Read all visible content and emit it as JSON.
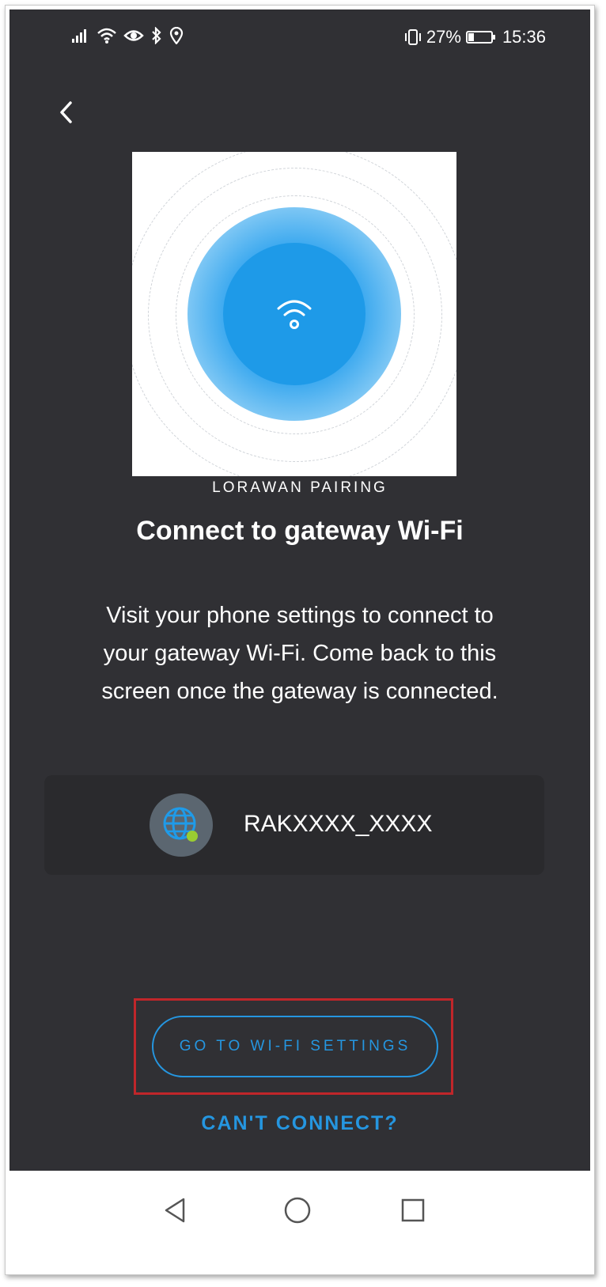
{
  "status_bar": {
    "battery_percent_text": "27%",
    "battery_level": 0.27,
    "time": "15:36",
    "icons": [
      "signal-icon",
      "wifi-icon",
      "eye-icon",
      "bluetooth-icon",
      "location-icon",
      "vibrate-icon",
      "battery-icon"
    ]
  },
  "header": {
    "back_icon": "chevron-left-icon"
  },
  "content": {
    "overline": "LORAWAN PAIRING",
    "title": "Connect to gateway Wi-Fi",
    "description": "Visit your phone settings to connect to your gateway Wi-Fi. Come back to this screen once the gateway is connected."
  },
  "network": {
    "icon": "globe-icon",
    "name": "RAKXXXX_XXXX"
  },
  "actions": {
    "wifi_settings_label": "GO TO WI-FI SETTINGS",
    "cant_connect_label": "CAN'T CONNECT?"
  },
  "colors": {
    "background": "#303034",
    "accent": "#2596e0",
    "highlight": "#c0262a"
  }
}
